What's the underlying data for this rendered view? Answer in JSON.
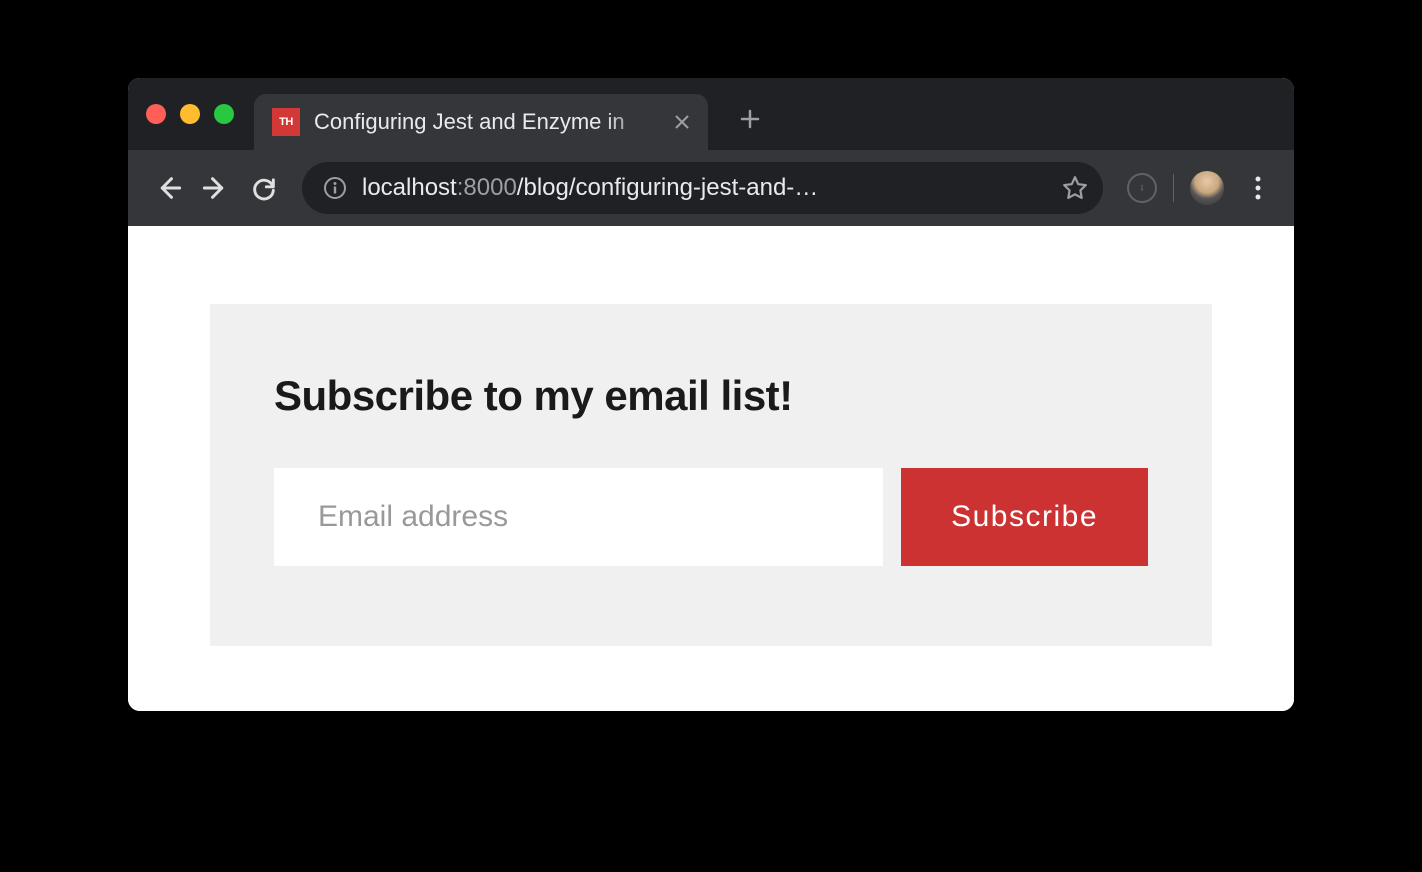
{
  "browser": {
    "tab": {
      "favicon_text": "TH",
      "title": "Configuring Jest and Enzyme in"
    },
    "url": {
      "host": "localhost",
      "port": ":8000",
      "path": "/blog/configuring-jest-and-…"
    }
  },
  "page": {
    "subscribe": {
      "heading": "Subscribe to my email list!",
      "placeholder": "Email address",
      "button_label": "Subscribe"
    }
  },
  "colors": {
    "accent": "#cc3232",
    "card_bg": "#f0f0f0"
  }
}
